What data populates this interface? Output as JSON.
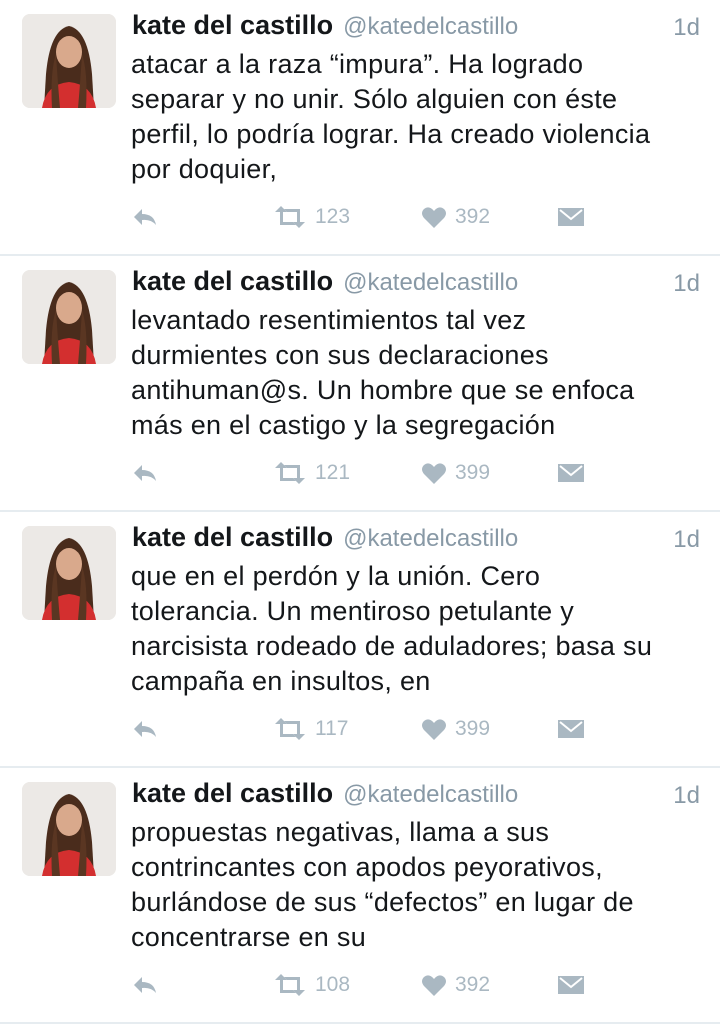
{
  "tweets": [
    {
      "name": "kate del castillo",
      "handle": "@katedelcastillo",
      "time": "1d",
      "text": "atacar a la raza “impura”. Ha logrado\nseparar y no unir. Sólo alguien con éste\nperfil, lo podría lograr. Ha creado violencia\npor doquier,",
      "retweets": "123",
      "likes": "392"
    },
    {
      "name": "kate del castillo",
      "handle": "@katedelcastillo",
      "time": "1d",
      "text": "levantado resentimientos tal vez\ndurmientes con sus declaraciones\nantihuman@s. Un hombre que se enfoca\nmás en el castigo y la segregación",
      "retweets": "121",
      "likes": "399"
    },
    {
      "name": "kate del castillo",
      "handle": "@katedelcastillo",
      "time": "1d",
      "text": "que en el perdón y la unión. Cero\ntolerancia. Un mentiroso petulante y\nnarcisista rodeado de aduladores; basa su\ncampaña en insultos, en",
      "retweets": "117",
      "likes": "399"
    },
    {
      "name": "kate del castillo",
      "handle": "@katedelcastillo",
      "time": "1d",
      "text": "propuestas negativas, llama a sus\ncontrincantes con apodos peyorativos,\nburlándose de sus “defectos” en lugar de\nconcentrarse en su",
      "retweets": "108",
      "likes": "392"
    }
  ],
  "icons": {
    "reply": "reply-icon",
    "retweet": "retweet-icon",
    "like": "heart-icon",
    "dm": "direct-message-icon"
  },
  "colors": {
    "text": "#14171a",
    "muted": "#8899a6",
    "action": "#aab8c2",
    "divider": "#e6ecf0",
    "avatar_top": "#d32f2f"
  }
}
